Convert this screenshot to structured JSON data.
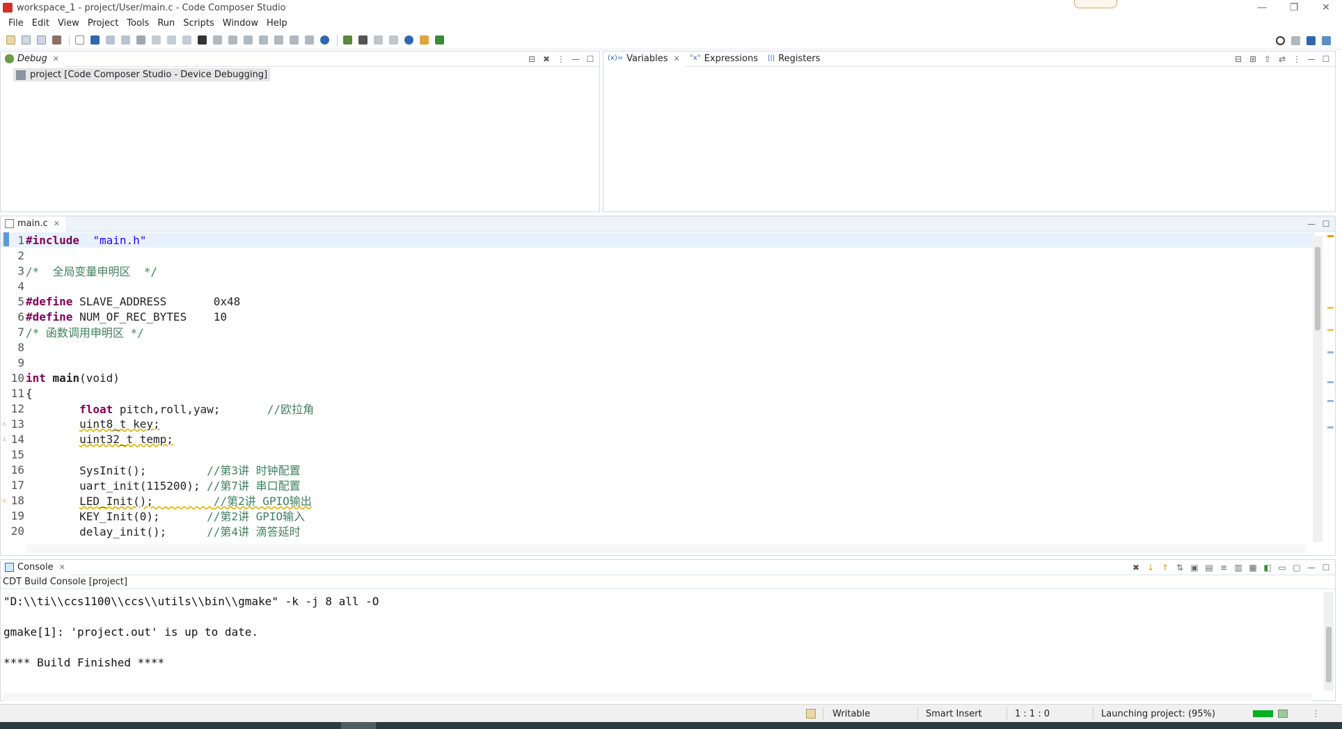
{
  "window": {
    "title": "workspace_1 - project/User/main.c - Code Composer Studio",
    "controls": [
      "—",
      "❐",
      "✕"
    ]
  },
  "menu": [
    "File",
    "Edit",
    "View",
    "Project",
    "Tools",
    "Run",
    "Scripts",
    "Window",
    "Help"
  ],
  "colors": {
    "keyword": "#7f0055",
    "string": "#2a00ff",
    "comment": "#3f7f5f",
    "current_line": "#e8f2fe",
    "progress": "#06b025"
  },
  "debug_view": {
    "tab_label": "Debug",
    "item": "project [Code Composer Studio - Device Debugging]"
  },
  "variables_view": {
    "tabs": [
      "Variables",
      "Expressions",
      "Registers"
    ]
  },
  "editor": {
    "tab_label": "main.c",
    "lines": [
      {
        "no": "1",
        "mark": ""
      },
      {
        "no": "2",
        "mark": ""
      },
      {
        "no": "3",
        "mark": ""
      },
      {
        "no": "4",
        "mark": ""
      },
      {
        "no": "5",
        "mark": ""
      },
      {
        "no": "6",
        "mark": ""
      },
      {
        "no": "7",
        "mark": ""
      },
      {
        "no": "8",
        "mark": ""
      },
      {
        "no": "9",
        "mark": ""
      },
      {
        "no": "10",
        "mark": ""
      },
      {
        "no": "11",
        "mark": ""
      },
      {
        "no": "12",
        "mark": ""
      },
      {
        "no": "13",
        "mark": "⚠"
      },
      {
        "no": "14",
        "mark": "⚠"
      },
      {
        "no": "15",
        "mark": ""
      },
      {
        "no": "16",
        "mark": ""
      },
      {
        "no": "17",
        "mark": ""
      },
      {
        "no": "18",
        "mark": "⚠"
      },
      {
        "no": "19",
        "mark": ""
      },
      {
        "no": "20",
        "mark": ""
      }
    ],
    "code": {
      "l1_kw": "#include",
      "l1_str": "  \"main.h\"",
      "l3_cmt": "/*  全局变量申明区  */",
      "l5_kw": "#define",
      "l5_rest": " SLAVE_ADDRESS       0x48",
      "l6_kw": "#define",
      "l6_rest": " NUM_OF_REC_BYTES    10",
      "l7_cmt": "/* 函数调用申明区 */",
      "l10_kw1": "int",
      "l10_kw2": "main",
      "l10_rest": "(void)",
      "l11": "{",
      "l12_indent": "        ",
      "l12_kw": "float",
      "l12_rest": " pitch,roll,yaw;       ",
      "l12_cmt": "//欧拉角",
      "l13_indent": "        ",
      "l13_code": "uint8_t key;",
      "l14_indent": "        ",
      "l14_code": "uint32_t temp;",
      "l16_code": "        SysInit();         ",
      "l16_cmt": "//第3讲 时钟配置",
      "l17_code": "        uart_init(115200); ",
      "l17_cmt": "//第7讲 串口配置",
      "l18_indent": "        ",
      "l18_code": "LED_Init();         ",
      "l18_cmt": "//第2讲 GPIO输出",
      "l19_code": "        KEY_Init(0);       ",
      "l19_cmt": "//第2讲 GPIO输入",
      "l20_code": "        delay_init();      ",
      "l20_cmt": "//第4讲 滴答延时"
    }
  },
  "console": {
    "tab_label": "Console",
    "subtitle": "CDT Build Console [project]",
    "lines": [
      "\"D:\\\\ti\\\\ccs1100\\\\ccs\\\\utils\\\\bin\\\\gmake\" -k -j 8 all -O",
      "gmake[1]: 'project.out' is up to date.",
      "**** Build Finished ****"
    ]
  },
  "status": {
    "writable": "Writable",
    "insert_mode": "Smart Insert",
    "position": "1 : 1 : 0",
    "launching": "Launching project: (95%)",
    "progress": 0.95
  }
}
